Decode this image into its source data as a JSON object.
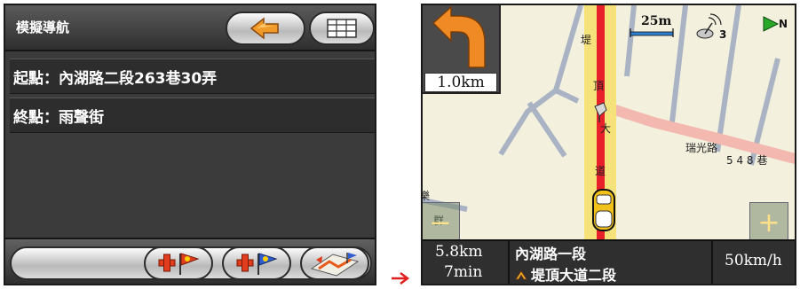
{
  "left_screen": {
    "title": "模擬導航",
    "start_label": "起點：內湖路二段263巷30弄",
    "end_label": "終點：雨聲街",
    "buttons": {
      "back_icon": "back-arrow-icon",
      "grid_icon": "grid-icon",
      "add_start_flag_icon": "start-flag-icon",
      "add_end_flag_icon": "end-flag-icon",
      "route_edit_icon": "route-edit-icon"
    }
  },
  "right_screen": {
    "turn_distance": "1.0km",
    "scale": "25m",
    "satellites": "3",
    "north": "N",
    "map_labels": {
      "road_vertical": [
        "堤",
        "頂",
        "大",
        "道"
      ],
      "road_horizontal": "瑞光路",
      "road_numbers": "5 4 8 巷",
      "left_partial_1": "樂",
      "left_partial_2": "群"
    },
    "remaining_distance": "5.8km",
    "remaining_time": "7min",
    "current_road": "內湖路一段",
    "next_road": "堤頂大道二段",
    "speed": "50km/h"
  },
  "colors": {
    "route_red": "#e8202a",
    "route_yellow": "#f6e27a",
    "turn_arrow_orange": "#f08a24",
    "dialog_dark": "#3b3b3b",
    "transition_arrow": "#e02020"
  }
}
